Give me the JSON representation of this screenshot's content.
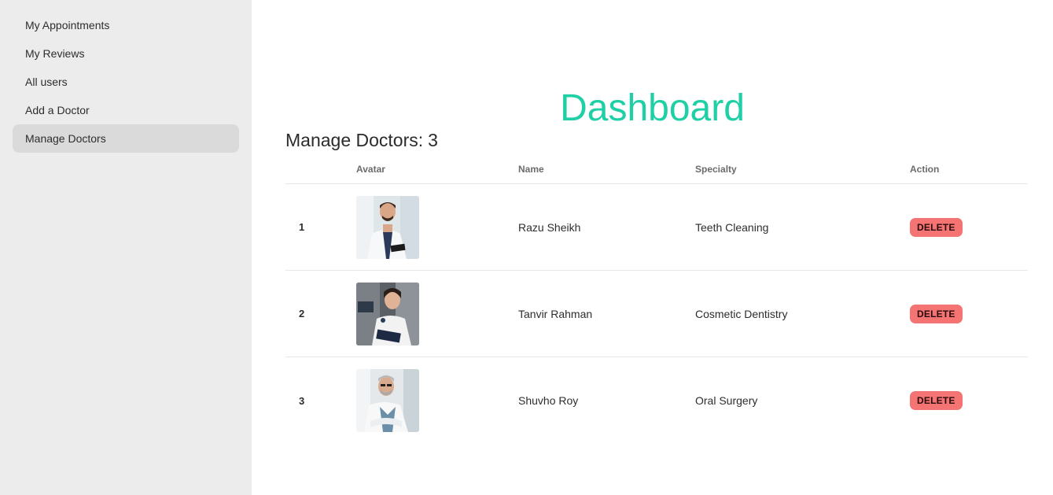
{
  "sidebar": {
    "items": [
      {
        "label": "My Appointments"
      },
      {
        "label": "My Reviews"
      },
      {
        "label": "All users"
      },
      {
        "label": "Add a Doctor"
      },
      {
        "label": "Manage Doctors",
        "active": true
      }
    ]
  },
  "main": {
    "title": "Dashboard",
    "manage_label": "Manage Doctors:",
    "doctor_count": "3"
  },
  "table": {
    "headers": {
      "index": "",
      "avatar": "Avatar",
      "name": "Name",
      "specialty": "Specialty",
      "action": "Action"
    },
    "rows": [
      {
        "index": "1",
        "name": "Razu Sheikh",
        "specialty": "Teeth Cleaning",
        "action": "DELETE",
        "avatar": "doctor-photo-1"
      },
      {
        "index": "2",
        "name": "Tanvir Rahman",
        "specialty": "Cosmetic Dentistry",
        "action": "DELETE",
        "avatar": "doctor-photo-2"
      },
      {
        "index": "3",
        "name": "Shuvho Roy",
        "specialty": "Oral Surgery",
        "action": "DELETE",
        "avatar": "doctor-photo-3"
      }
    ]
  },
  "colors": {
    "accent": "#1fcfa6",
    "delete": "#f47373",
    "sidebar_bg": "#ececec",
    "active_bg": "#dadada"
  }
}
